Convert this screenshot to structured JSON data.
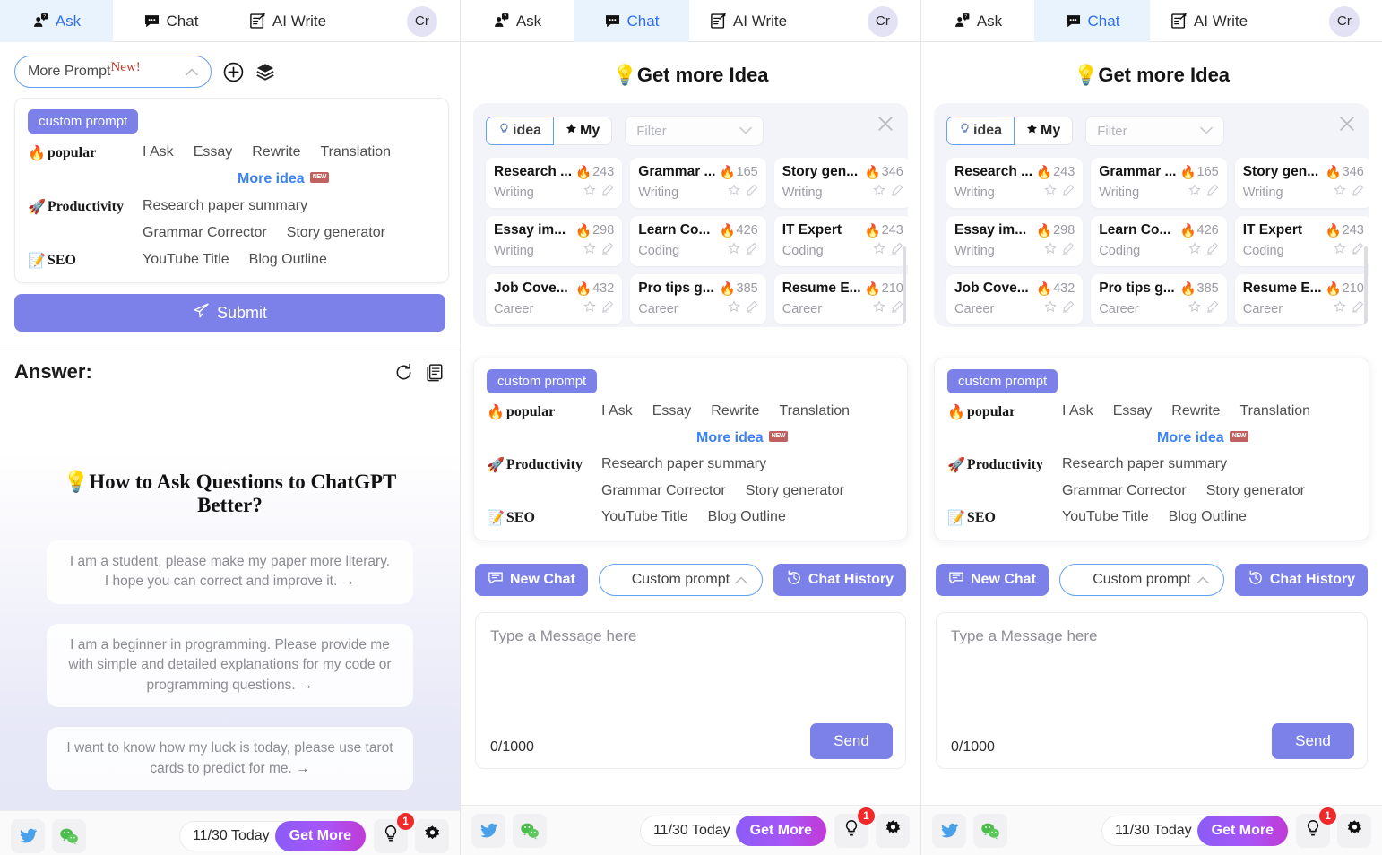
{
  "tabs": [
    {
      "label": "Ask",
      "icon": "person-question-icon",
      "active_in": [
        0
      ]
    },
    {
      "label": "Chat",
      "icon": "chat-bubble-icon",
      "active_in": [
        1,
        2
      ]
    },
    {
      "label": "AI Write",
      "icon": "write-note-icon",
      "active_in": []
    }
  ],
  "avatar": {
    "initials": "Cr"
  },
  "ask_panel": {
    "more_prompt": {
      "label": "More Prompt",
      "badge": "New!",
      "caret": "chevron-up-icon"
    },
    "add_icon": "plus-circle-icon",
    "layers_icon": "layers-icon",
    "chip": "custom prompt",
    "groups": [
      {
        "emoji": "🔥",
        "name": "popular",
        "items": [
          "I Ask",
          "Essay",
          "Rewrite",
          "Translation"
        ],
        "more": {
          "label": "More idea",
          "badge": "NEW"
        }
      },
      {
        "emoji": "🚀",
        "name": "Productivity",
        "items": [
          "Research paper summary",
          "Grammar Corrector",
          "Story generator"
        ]
      },
      {
        "emoji": "📝",
        "name": "SEO",
        "items": [
          "YouTube Title",
          "Blog Outline"
        ]
      }
    ],
    "submit_label": "Submit",
    "answer_label": "Answer:",
    "refresh_icon": "refresh-icon",
    "copy_icon": "copy-icon",
    "answer_heading": "💡How to Ask Questions to ChatGPT Better?",
    "suggestions": [
      "I am a student, please make my paper more literary. I hope you can correct and improve it.",
      "I am a beginner in programming. Please provide me with simple and detailed explanations for my code or programming questions.",
      "I want to know how my luck is today, please use tarot cards to predict for me."
    ],
    "suggestion_arrow": "→"
  },
  "chat_panel": {
    "title": "💡Get more Idea",
    "segments": [
      {
        "label": "idea",
        "icon": "bulb-icon",
        "selected": true
      },
      {
        "label": "My",
        "icon": "star-icon",
        "selected": false
      }
    ],
    "filter_placeholder": "Filter",
    "filter_caret": "chevron-down-icon",
    "close_icon": "close-icon",
    "idea_cards": [
      {
        "name": "Research ...",
        "hot": "243",
        "category": "Writing"
      },
      {
        "name": "Grammar ...",
        "hot": "165",
        "category": "Writing"
      },
      {
        "name": "Story gen...",
        "hot": "346",
        "category": "Writing"
      },
      {
        "name": "Essay im...",
        "hot": "298",
        "category": "Writing"
      },
      {
        "name": "Learn Co...",
        "hot": "426",
        "category": "Coding"
      },
      {
        "name": "IT Expert",
        "hot": "243",
        "category": "Coding"
      },
      {
        "name": "Job Cove...",
        "hot": "432",
        "category": "Career"
      },
      {
        "name": "Pro tips g...",
        "hot": "385",
        "category": "Career"
      },
      {
        "name": "Resume E...",
        "hot": "210",
        "category": "Career"
      }
    ],
    "card_star_icon": "star-outline-icon",
    "card_edit_icon": "pencil-icon",
    "hot_icon": "🔥",
    "custom_prompt_chip": "custom prompt",
    "groups": [
      {
        "emoji": "🔥",
        "name": "popular",
        "items": [
          "I Ask",
          "Essay",
          "Rewrite",
          "Translation"
        ],
        "more": {
          "label": "More idea",
          "badge": "NEW"
        }
      },
      {
        "emoji": "🚀",
        "name": "Productivity",
        "items": [
          "Research paper summary",
          "Grammar Corrector",
          "Story generator"
        ]
      },
      {
        "emoji": "📝",
        "name": "SEO",
        "items": [
          "YouTube Title",
          "Blog Outline"
        ]
      }
    ],
    "new_chat_label": "New Chat",
    "new_chat_icon": "new-chat-icon",
    "prompt_select_value": "Custom prompt",
    "prompt_select_caret": "chevron-up-icon",
    "chat_history_label": "Chat History",
    "chat_history_icon": "history-icon",
    "composer_placeholder": "Type a Message here",
    "composer_count": "0/1000",
    "send_label": "Send"
  },
  "bottom_bar": {
    "twitter_icon": "twitter-icon",
    "wechat_icon": "wechat-icon",
    "date_label": "11/30 Today",
    "get_more_label": "Get More",
    "bulb_icon": "bulb-icon",
    "bulb_badge": "1",
    "gear_icon": "gear-icon"
  },
  "colors": {
    "accent_purple": "#7b81e8",
    "tab_active_bg": "#e8f3fe",
    "tab_active_text": "#2d6ff0",
    "badge_red": "#f02a2a",
    "link_blue": "#3b82f6",
    "get_more_gradient_start": "#8b5cf6",
    "get_more_gradient_end": "#c03ad6"
  }
}
